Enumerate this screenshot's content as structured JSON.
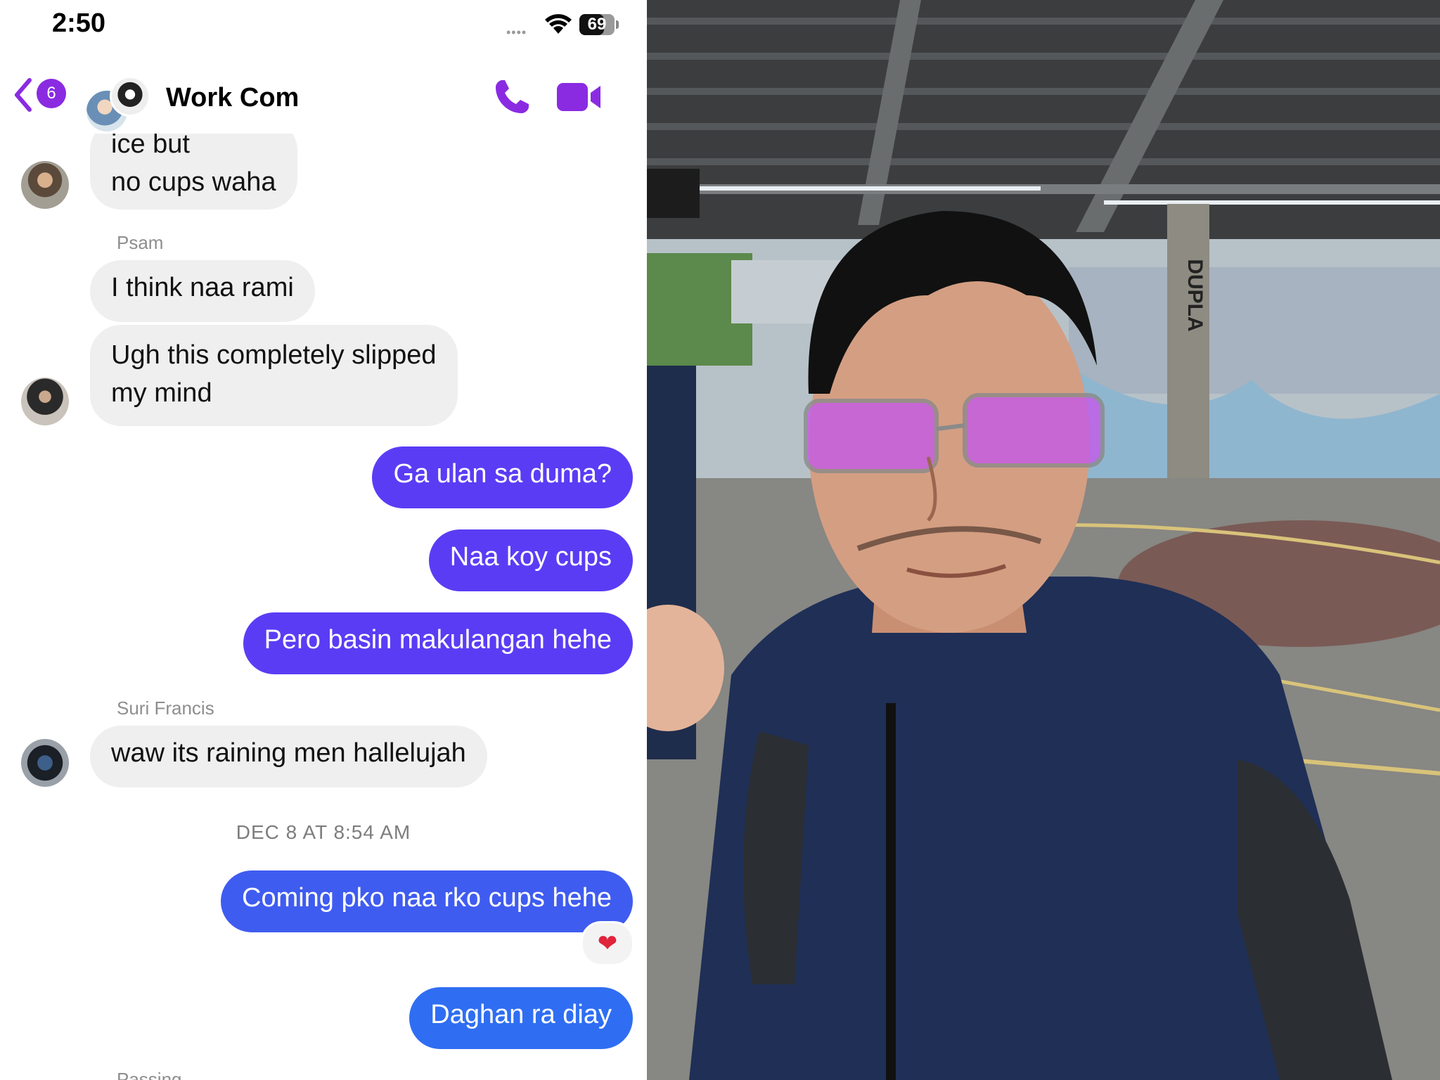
{
  "status": {
    "time": "2:50",
    "signal": "••••",
    "battery": "69",
    "battery_fraction": 0.69
  },
  "header": {
    "back_count": "6",
    "title": "Work Com"
  },
  "messages": [
    {
      "dir": "in",
      "text_line1": "ice but",
      "text_line2": "no cups waha"
    },
    {
      "dir": "in",
      "sender": "Psam",
      "text": "I think naa rami"
    },
    {
      "dir": "in",
      "text_line1": "Ugh this completely slipped",
      "text_line2": "my mind"
    },
    {
      "dir": "out",
      "text": "Ga ulan sa duma?"
    },
    {
      "dir": "out",
      "text": "Naa koy cups"
    },
    {
      "dir": "out",
      "text": "Pero basin makulangan hehe"
    },
    {
      "dir": "in",
      "sender": "Suri Francis",
      "text": "waw its raining men hallelujah"
    },
    {
      "dir": "out",
      "text": "Coming pko naa rko cups hehe",
      "reaction": "❤"
    },
    {
      "dir": "out",
      "text": "Daghan ra diay"
    }
  ],
  "date_separator": "DEC 8 AT 8:54 AM",
  "next_sender_partial": "Passing",
  "photo": {
    "court_sign": "DUPLA"
  },
  "colors": {
    "accent": "#8a2be2",
    "outgoing_bubble": "#5b3cf5",
    "incoming_bubble": "#efefef"
  },
  "icons": [
    "back-chevron-icon",
    "phone-icon",
    "video-camera-icon",
    "wifi-icon",
    "battery-icon",
    "heart-reaction-icon"
  ]
}
